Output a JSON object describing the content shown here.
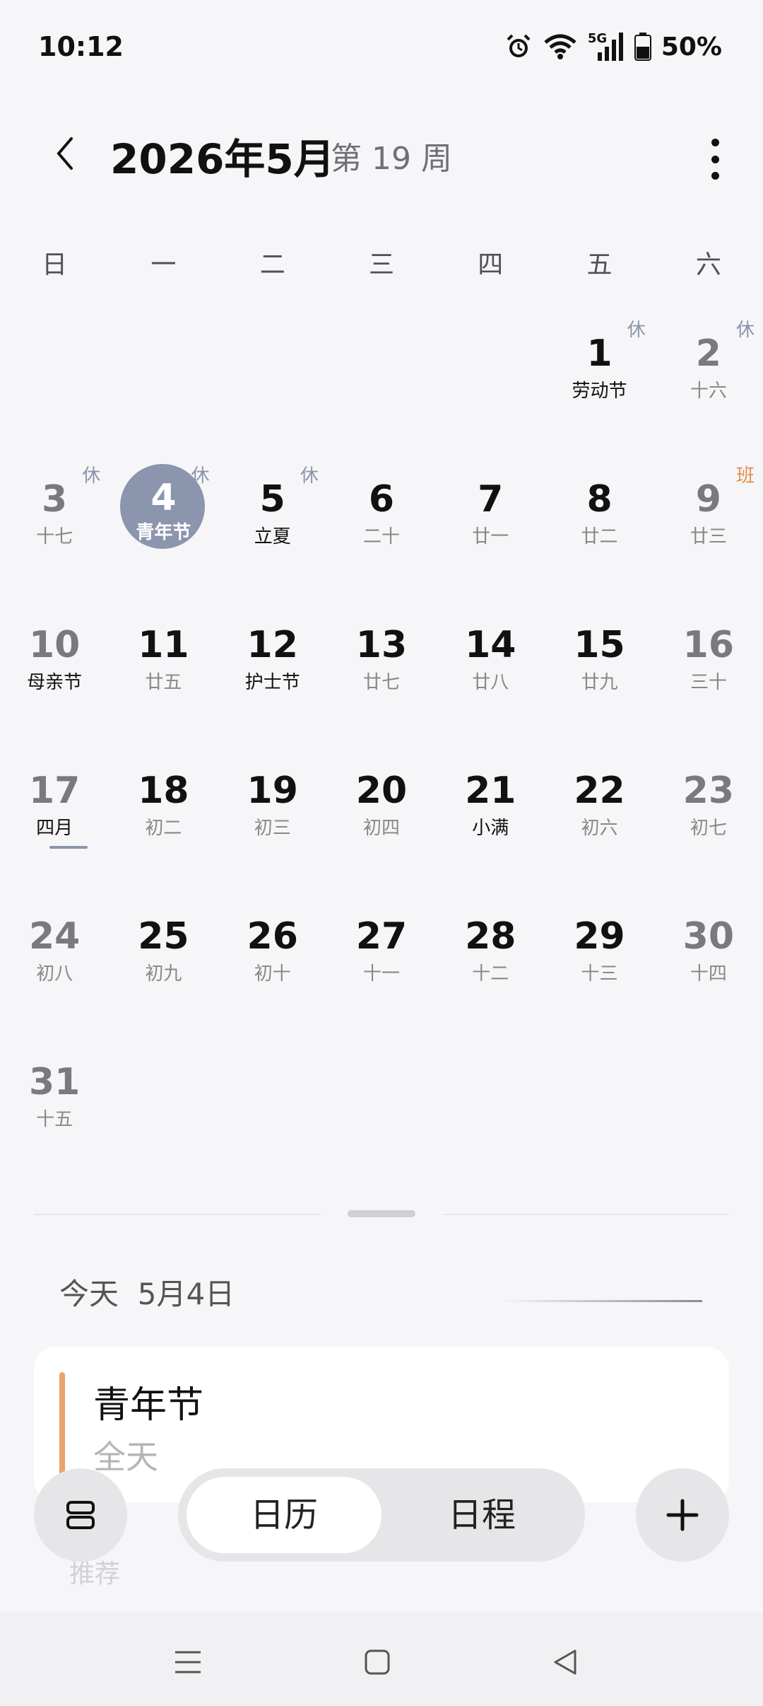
{
  "status": {
    "time": "10:12",
    "network": "5G",
    "battery": "50%",
    "icons": [
      "alarm-icon",
      "wifi-icon",
      "5g-signal-icon",
      "battery-icon"
    ]
  },
  "header": {
    "title": "2026年5月",
    "week": "第 19 周"
  },
  "weekdays": [
    "日",
    "一",
    "二",
    "三",
    "四",
    "五",
    "六"
  ],
  "weeks": [
    [
      {
        "day": "",
        "sub": ""
      },
      {
        "day": "",
        "sub": ""
      },
      {
        "day": "",
        "sub": ""
      },
      {
        "day": "",
        "sub": ""
      },
      {
        "day": "",
        "sub": ""
      },
      {
        "day": "1",
        "sub": "劳动节",
        "tag": "休"
      },
      {
        "day": "2",
        "sub": "十六",
        "tag": "休"
      }
    ],
    [
      {
        "day": "3",
        "sub": "十七",
        "tag": "休"
      },
      {
        "day": "4",
        "sub": "青年节",
        "tag": "休"
      },
      {
        "day": "5",
        "sub": "立夏",
        "tag": "休"
      },
      {
        "day": "6",
        "sub": "二十"
      },
      {
        "day": "7",
        "sub": "廿一"
      },
      {
        "day": "8",
        "sub": "廿二"
      },
      {
        "day": "9",
        "sub": "廿三",
        "tag": "班"
      }
    ],
    [
      {
        "day": "10",
        "sub": "母亲节"
      },
      {
        "day": "11",
        "sub": "廿五"
      },
      {
        "day": "12",
        "sub": "护士节"
      },
      {
        "day": "13",
        "sub": "廿七"
      },
      {
        "day": "14",
        "sub": "廿八"
      },
      {
        "day": "15",
        "sub": "廿九"
      },
      {
        "day": "16",
        "sub": "三十"
      }
    ],
    [
      {
        "day": "17",
        "sub": "四月"
      },
      {
        "day": "18",
        "sub": "初二"
      },
      {
        "day": "19",
        "sub": "初三"
      },
      {
        "day": "20",
        "sub": "初四"
      },
      {
        "day": "21",
        "sub": "小满"
      },
      {
        "day": "22",
        "sub": "初六"
      },
      {
        "day": "23",
        "sub": "初七"
      }
    ],
    [
      {
        "day": "24",
        "sub": "初八"
      },
      {
        "day": "25",
        "sub": "初九"
      },
      {
        "day": "26",
        "sub": "初十"
      },
      {
        "day": "27",
        "sub": "十一"
      },
      {
        "day": "28",
        "sub": "十二"
      },
      {
        "day": "29",
        "sub": "十三"
      },
      {
        "day": "30",
        "sub": "十四"
      }
    ],
    [
      {
        "day": "31",
        "sub": "十五"
      },
      {
        "day": "",
        "sub": ""
      },
      {
        "day": "",
        "sub": ""
      },
      {
        "day": "",
        "sub": ""
      },
      {
        "day": "",
        "sub": ""
      },
      {
        "day": "",
        "sub": ""
      },
      {
        "day": "",
        "sub": ""
      }
    ]
  ],
  "today": {
    "label": "今天",
    "date": "5月4日"
  },
  "event": {
    "title": "青年节",
    "time": "全天",
    "color": "#e9a46b"
  },
  "recommend_label": "推荐",
  "bottom": {
    "tab_calendar": "日历",
    "tab_schedule": "日程"
  },
  "colors": {
    "accent": "#8b95ad",
    "work_tag": "#e08e4a"
  }
}
